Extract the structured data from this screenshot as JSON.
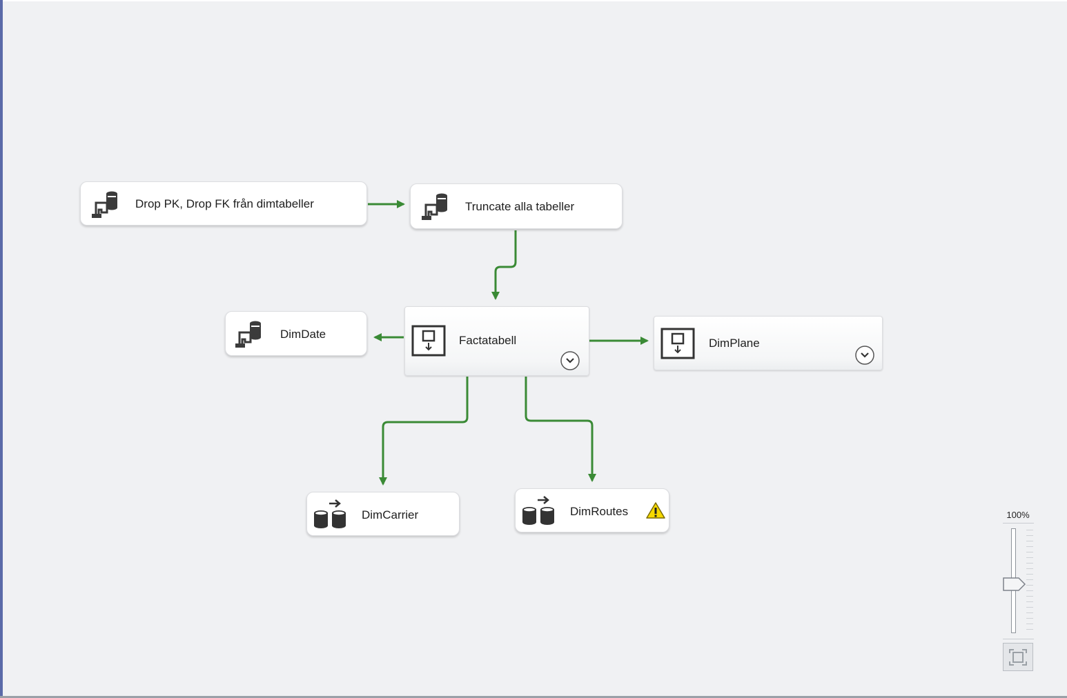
{
  "tasks": {
    "drop_pk": {
      "label": "Drop PK, Drop FK från dimtabeller",
      "icon": "execute-sql-task-icon"
    },
    "truncate": {
      "label": "Truncate alla tabeller",
      "icon": "execute-sql-task-icon"
    },
    "dimdate": {
      "label": "DimDate",
      "icon": "execute-sql-task-icon"
    },
    "factatabell": {
      "label": "Factatabell",
      "icon": "sequence-container-icon",
      "expander": "chevron-down-icon"
    },
    "dimplane": {
      "label": "DimPlane",
      "icon": "sequence-container-icon",
      "expander": "chevron-down-icon"
    },
    "dimcarrier": {
      "label": "DimCarrier",
      "icon": "data-flow-task-icon"
    },
    "dimroutes": {
      "label": "DimRoutes",
      "icon": "data-flow-task-icon",
      "status": "warning-icon"
    }
  },
  "zoom": {
    "level_label": "100%",
    "level": 100
  },
  "colors": {
    "canvas": "#f0f1f3",
    "precedence_success": "#3a8a35",
    "accent_left_border": "#5b6aa8"
  }
}
